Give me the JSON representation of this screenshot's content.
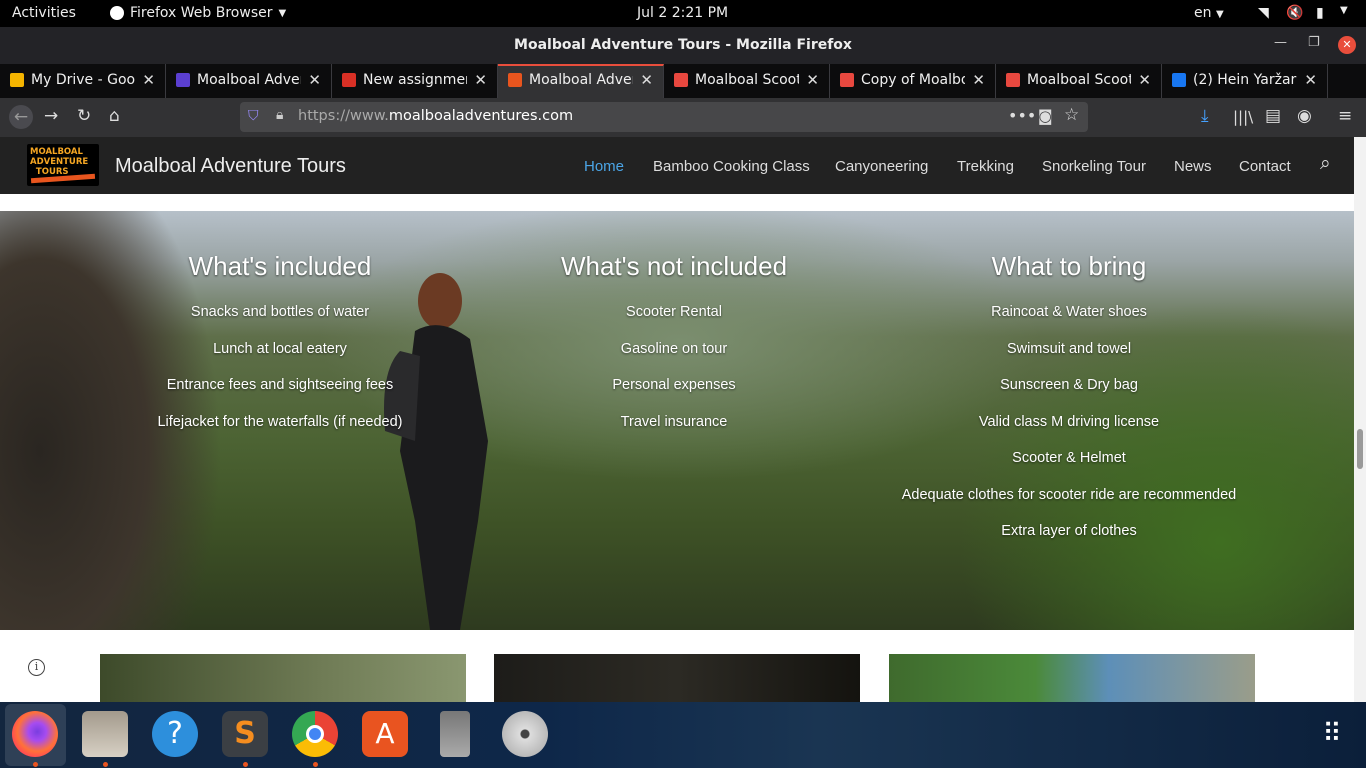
{
  "system_bar": {
    "activities": "Activities",
    "app_menu": "Firefox Web Browser",
    "clock": "Jul 2   2:21 PM",
    "lang": "en"
  },
  "window": {
    "title": "Moalboal Adventure Tours - Mozilla Firefox"
  },
  "tabs": [
    {
      "label": "My Drive - Goog",
      "color": "#f4b400"
    },
    {
      "label": "Moalboal Adven",
      "color": "#5b3fd1"
    },
    {
      "label": "New assignmen",
      "color": "#d93025"
    },
    {
      "label": "Moalboal Adven",
      "color": "#e8551e"
    },
    {
      "label": "Moalboal Scoot",
      "color": "#e8483f"
    },
    {
      "label": "Copy of Moalbo",
      "color": "#e8483f"
    },
    {
      "label": "Moalboal Scoot",
      "color": "#e8483f"
    },
    {
      "label": "(2) Hein Yaržar",
      "color": "#1877f2"
    }
  ],
  "url": {
    "prefix": "https://www.",
    "domain": "moalboaladventures.com"
  },
  "site": {
    "logo_text": "MOALBOAL\nADVENTURE\nTOURS",
    "name": "Moalboal Adventure Tours",
    "menu": [
      "Home",
      "Bamboo Cooking Class",
      "Canyoneering",
      "Trekking",
      "Snorkeling Tour",
      "News",
      "Contact"
    ]
  },
  "sections": {
    "included": {
      "title": "What's included",
      "items": [
        "Snacks and bottles of water",
        "Lunch at local eatery",
        "Entrance fees and sightseeing fees",
        "Lifejacket for the waterfalls (if needed)"
      ]
    },
    "not_included": {
      "title": "What's not included",
      "items": [
        "Scooter Rental",
        "Gasoline on tour",
        "Personal expenses",
        "Travel insurance"
      ]
    },
    "bring": {
      "title": "What to bring",
      "items": [
        "Raincoat & Water shoes",
        "Swimsuit and towel",
        "Sunscreen & Dry bag",
        "Valid class M driving license",
        "Scooter & Helmet",
        "Adequate clothes for scooter ride are recommended",
        "Extra layer of clothes"
      ]
    }
  },
  "icons": {
    "info": "i"
  }
}
